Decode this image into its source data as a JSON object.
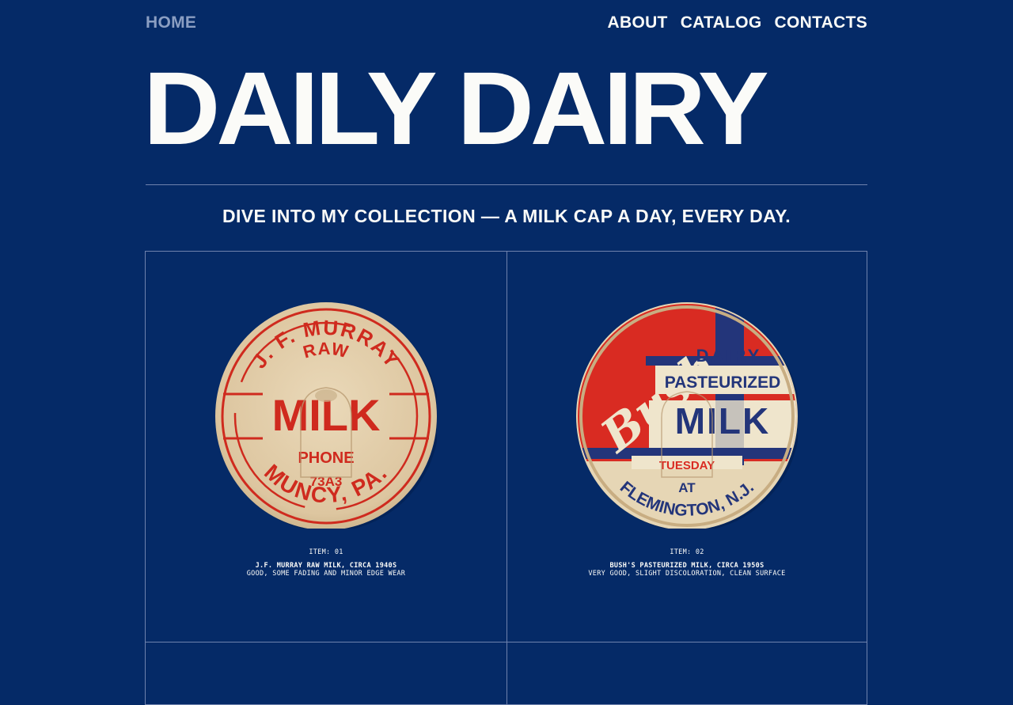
{
  "nav": {
    "home": "HOME",
    "about": "ABOUT",
    "catalog": "CATALOG",
    "contacts": "CONTACTS"
  },
  "site_title": "DAILY DAIRY",
  "tagline": "DIVE INTO MY COLLECTION — A MILK CAP A DAY, EVERY DAY.",
  "items": [
    {
      "item_label": "ITEM: 01",
      "name": "J.F. MURRAY RAW MILK, CIRCA 1940S",
      "condition": "GOOD, SOME FADING AND MINOR EDGE WEAR",
      "cap": {
        "top_arc": "J. F. MURRAY",
        "raw": "RAW",
        "milk": "MILK",
        "phone": "PHONE",
        "number": "73A3",
        "bottom_arc": "MUNCY, PA."
      }
    },
    {
      "item_label": "ITEM: 02",
      "name": "BUSH'S PASTEURIZED MILK, CIRCA 1950S",
      "condition": "VERY GOOD, SLIGHT DISCOLORATION, CLEAN SURFACE",
      "cap": {
        "script": "Bush",
        "dairy": "DAIRY",
        "pasteurized": "PASTEURIZED",
        "milk": "MILK",
        "day": "TUESDAY",
        "at": "AT",
        "bottom_arc": "FLEMINGTON, N.J."
      }
    }
  ],
  "colors": {
    "background": "#052a67",
    "text": "#fbfbf8",
    "nav_active": "#8b9ec2",
    "rule": "#6f82ad",
    "cap_paper": "#e4d1ae",
    "cap_red": "#cf2a1e",
    "cap_blue": "#23357a"
  }
}
